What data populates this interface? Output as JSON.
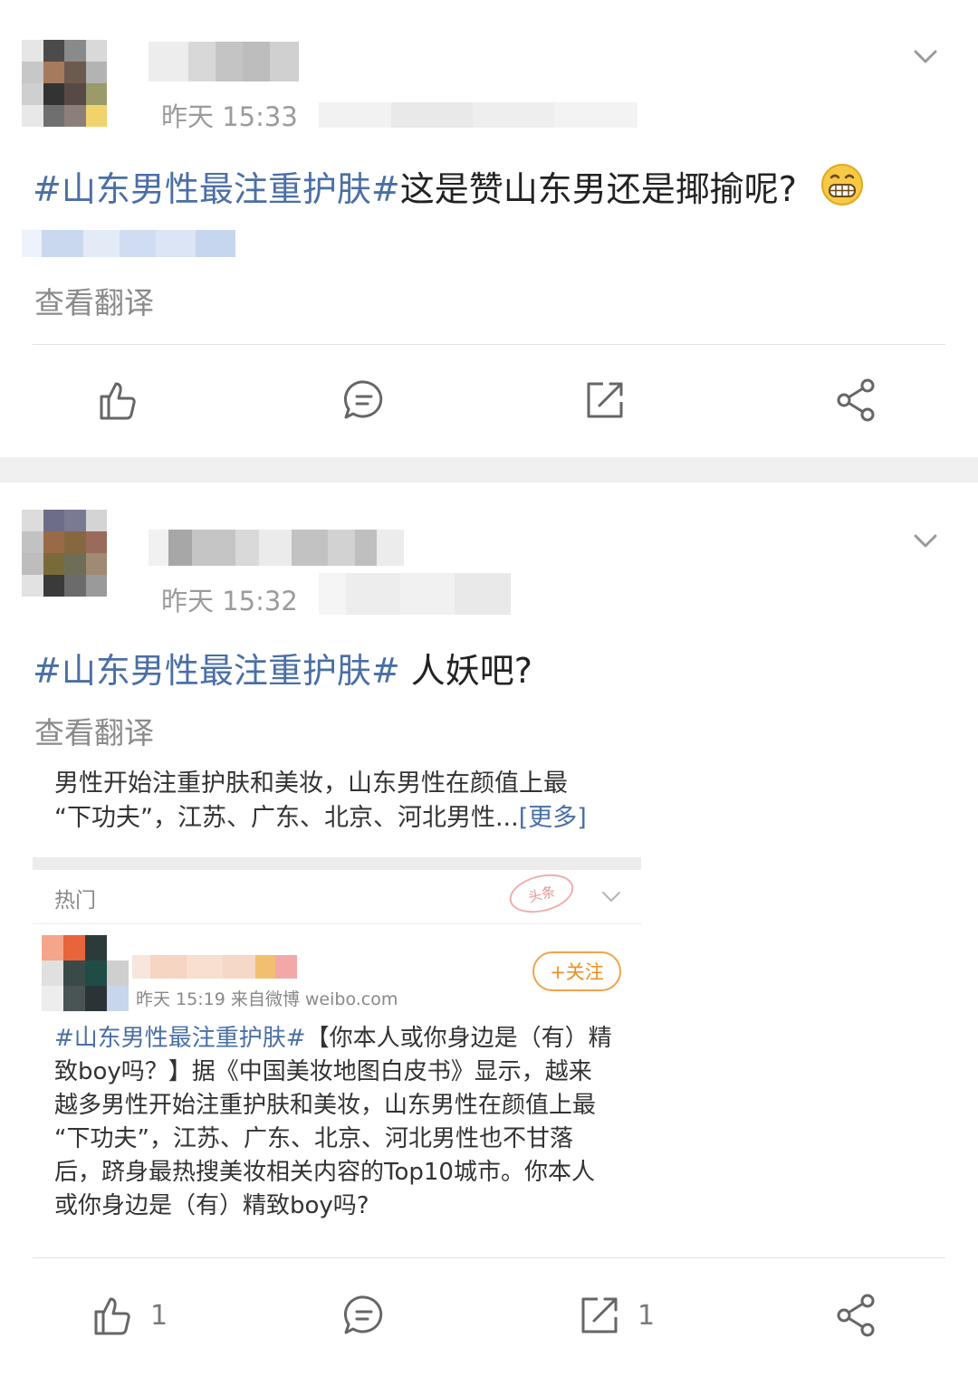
{
  "posts": [
    {
      "time": "昨天 15:33",
      "topic": "#山东男性最注重护肤#",
      "text": "这是赞山东男还是揶揄呢?",
      "translate": "查看翻译",
      "actions": {
        "like_count": "",
        "repost_count": ""
      }
    },
    {
      "time": "昨天 15:32",
      "topic": "#山东男性最注重护肤#",
      "text": " 人妖吧?",
      "translate": "查看翻译",
      "summary": {
        "line1": "男性开始注重护肤和美妆，山东男性在颜值上最",
        "line2": "“下功夫”，江苏、广东、北京、河北男性...",
        "more": "[更多]"
      },
      "card": {
        "section": "热门",
        "stamp": "头条",
        "follow": "+关注",
        "meta": "昨天 15:19  来自微博 weibo.com",
        "topic": "#山东男性最注重护肤#",
        "lines": [
          "【你本人或你身边是（有）精",
          "致boy吗？】据《中国美妆地图白皮书》显示，越来",
          "越多男性开始注重护肤和美妆，山东男性在颜值上最",
          "“下功夫”，江苏、广东、北京、河北男性也不甘落",
          "后，跻身最热搜美妆相关内容的Top10城市。你本人",
          "或你身边是（有）精致boy吗?"
        ]
      },
      "actions": {
        "like_count": "1",
        "repost_count": "1"
      }
    }
  ],
  "colors": {
    "topic": "#4a6fa5",
    "follow": "#f08c1e",
    "icon": "#666666"
  },
  "icons": [
    "like-icon",
    "comment-icon",
    "repost-icon",
    "share-icon",
    "chevron-down-icon",
    "grin-emoji-icon"
  ]
}
